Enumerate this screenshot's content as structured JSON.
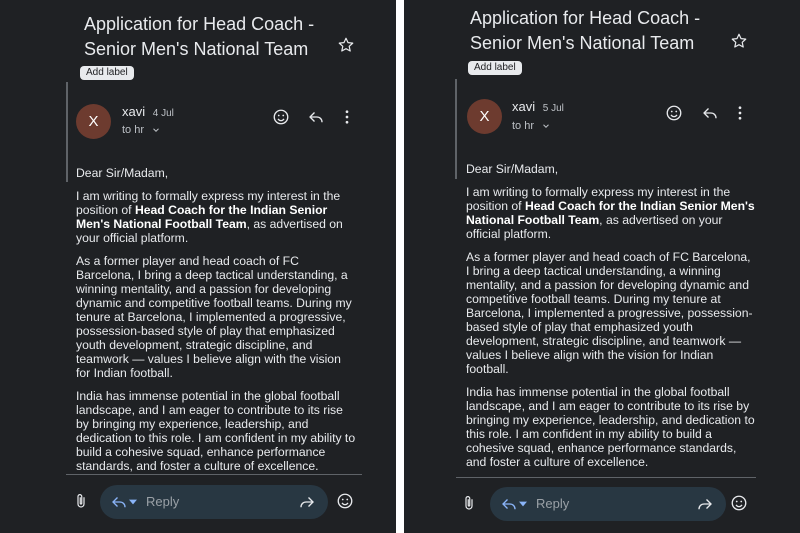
{
  "colors": {
    "background": "#1f2124",
    "text": "#e8eaed",
    "muted": "#bdc1c6",
    "avatar": "#6d3b2f",
    "reply_bar": "#283742"
  },
  "screens": [
    {
      "subject": "Application for Head Coach - Senior Men's National Team",
      "add_label": "Add label",
      "avatar_initial": "X",
      "sender_name": "xavi",
      "date": "4 Jul",
      "recipient": "to hr",
      "icons": {
        "star": "star-icon",
        "emoji": "emoji-icon",
        "reply": "reply-icon",
        "more": "more-vert-icon",
        "attach": "attach-icon",
        "forward": "forward-icon"
      },
      "body": {
        "greeting": "Dear Sir/Madam,",
        "p1_a": "I am writing to formally express my interest in the position of ",
        "p1_bold": "Head Coach for the Indian Senior Men's National Football Team",
        "p1_b": ", as advertised on your official platform.",
        "p2": "As a former player and head coach of FC Barcelona, I bring a deep tactical understanding, a winning mentality, and a passion for developing dynamic and competitive football teams. During my tenure at Barcelona, I implemented a progressive, possession-based style of play that emphasized youth development, strategic discipline, and teamwork — values I believe align with the vision for Indian football.",
        "p3": "India has immense potential in the global football landscape, and I am eager to contribute to its rise by bringing my experience, leadership, and dedication to this role. I am confident in my ability to build a cohesive squad, enhance performance standards, and foster a culture of excellence."
      },
      "reply_placeholder": "Reply"
    },
    {
      "subject": "Application for Head Coach - Senior Men's National Team",
      "add_label": "Add label",
      "avatar_initial": "X",
      "sender_name": "xavi",
      "date": "5 Jul",
      "recipient": "to hr",
      "icons": {
        "star": "star-icon",
        "emoji": "emoji-icon",
        "reply": "reply-icon",
        "more": "more-vert-icon",
        "attach": "attach-icon",
        "forward": "forward-icon"
      },
      "body": {
        "greeting": "Dear Sir/Madam,",
        "p1_a": "I am writing to formally express my interest in the position of ",
        "p1_bold": "Head Coach for the Indian Senior Men's National Football Team",
        "p1_b": ", as advertised on your official platform.",
        "p2": "As a former player and head coach of FC Barcelona, I bring a deep tactical understanding, a winning mentality, and a passion for developing dynamic and competitive football teams. During my tenure at Barcelona, I implemented a progressive, possession-based style of play that emphasized youth development, strategic discipline, and teamwork — values I believe align with the vision for Indian football.",
        "p3": "India has immense potential in the global football landscape, and I am eager to contribute to its rise by bringing my experience, leadership, and dedication to this role. I am confident in my ability to build a cohesive squad, enhance performance standards, and foster a culture of excellence."
      },
      "reply_placeholder": "Reply"
    }
  ]
}
